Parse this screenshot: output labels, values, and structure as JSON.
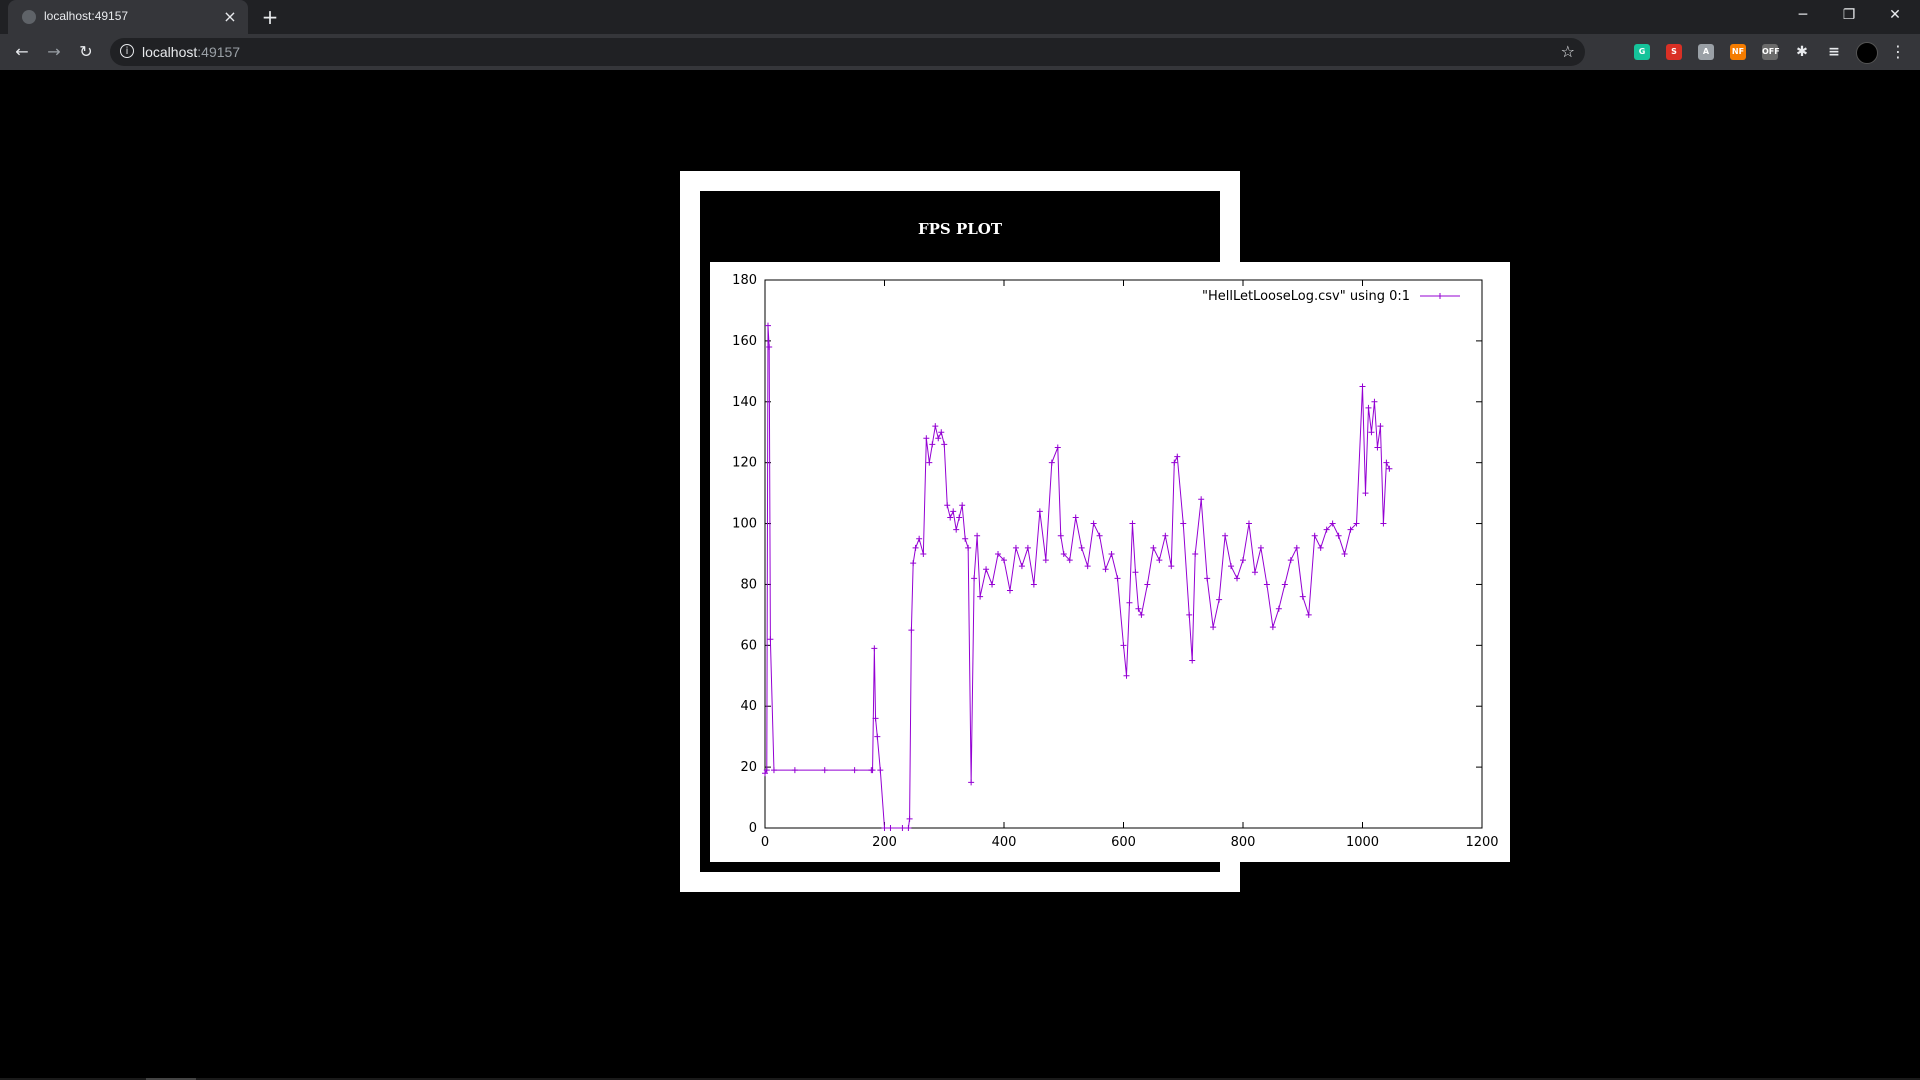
{
  "browser": {
    "tab_title": "localhost:49157",
    "address_host": "localhost",
    "address_port": ":49157",
    "tab_close_icon": "×",
    "new_tab_icon": "+",
    "win_minimize": "─",
    "win_restore": "❐",
    "win_close": "✕",
    "back_icon": "←",
    "forward_icon": "→",
    "reload_icon": "↻",
    "star_icon": "☆",
    "menu_icon": "⋮",
    "info_icon": "i",
    "extensions": [
      {
        "name": "grammarly-extension-icon",
        "label": "G",
        "color": "#15c39a"
      },
      {
        "name": "s-extension-icon",
        "label": "S",
        "color": "#d93025"
      },
      {
        "name": "gray-extension-icon",
        "label": "A",
        "color": "#9aa0a6"
      },
      {
        "name": "orange-extension-icon",
        "label": "NF",
        "color": "#f57c00"
      },
      {
        "name": "off-extension-icon",
        "label": "OFF",
        "color": "#6b6b6b"
      },
      {
        "name": "puzzle-extensions-icon",
        "label": "✱",
        "color": "#35363a"
      },
      {
        "name": "media-queue-icon",
        "label": "≡",
        "color": "#35363a"
      }
    ]
  },
  "page": {
    "title": "FPS PLOT"
  },
  "chart_data": {
    "type": "line",
    "title": "",
    "xlabel": "",
    "ylabel": "",
    "xlim": [
      0,
      1200
    ],
    "ylim": [
      0,
      180
    ],
    "x_ticks": [
      "0",
      "200",
      "400",
      "600",
      "800",
      "1000",
      "1200"
    ],
    "y_ticks": [
      "0",
      "20",
      "40",
      "60",
      "80",
      "100",
      "120",
      "140",
      "160",
      "180"
    ],
    "grid": false,
    "legend_position": "top-right",
    "series": [
      {
        "name": "\"HellLetLooseLog.csv\" using 0:1",
        "color": "#9400d3",
        "marker": "+",
        "x": [
          0,
          3,
          5,
          7,
          9,
          15,
          50,
          100,
          150,
          178,
          180,
          183,
          185,
          188,
          193,
          200,
          210,
          230,
          240,
          242,
          245,
          248,
          252,
          258,
          265,
          270,
          275,
          280,
          285,
          290,
          295,
          300,
          305,
          310,
          315,
          320,
          325,
          330,
          335,
          340,
          345,
          350,
          355,
          360,
          370,
          380,
          390,
          400,
          410,
          420,
          430,
          440,
          450,
          460,
          470,
          480,
          490,
          495,
          500,
          510,
          520,
          530,
          540,
          550,
          560,
          570,
          580,
          590,
          600,
          605,
          610,
          615,
          620,
          625,
          630,
          640,
          650,
          660,
          670,
          680,
          685,
          690,
          700,
          710,
          715,
          720,
          730,
          740,
          750,
          760,
          770,
          780,
          790,
          800,
          810,
          820,
          830,
          840,
          850,
          860,
          870,
          880,
          890,
          900,
          910,
          920,
          930,
          940,
          950,
          960,
          970,
          980,
          990,
          1000,
          1005,
          1010,
          1015,
          1020,
          1025,
          1030,
          1035,
          1040,
          1045
        ],
        "y": [
          18,
          19,
          165,
          158,
          62,
          19,
          19,
          19,
          19,
          19,
          19,
          59,
          36,
          30,
          19,
          0,
          0,
          0,
          0,
          3,
          65,
          87,
          92,
          95,
          90,
          128,
          120,
          126,
          132,
          128,
          130,
          126,
          106,
          102,
          104,
          98,
          102,
          106,
          95,
          92,
          15,
          82,
          96,
          76,
          85,
          80,
          90,
          88,
          78,
          92,
          86,
          92,
          80,
          104,
          88,
          120,
          125,
          96,
          90,
          88,
          102,
          92,
          86,
          100,
          96,
          85,
          90,
          82,
          60,
          50,
          74,
          100,
          84,
          72,
          70,
          80,
          92,
          88,
          96,
          86,
          120,
          122,
          100,
          70,
          55,
          90,
          108,
          82,
          66,
          75,
          96,
          86,
          82,
          88,
          100,
          84,
          92,
          80,
          66,
          72,
          80,
          88,
          92,
          76,
          70,
          96,
          92,
          98,
          100,
          96,
          90,
          98,
          100,
          145,
          110,
          138,
          130,
          140,
          125,
          132,
          100,
          120,
          118
        ]
      }
    ]
  }
}
